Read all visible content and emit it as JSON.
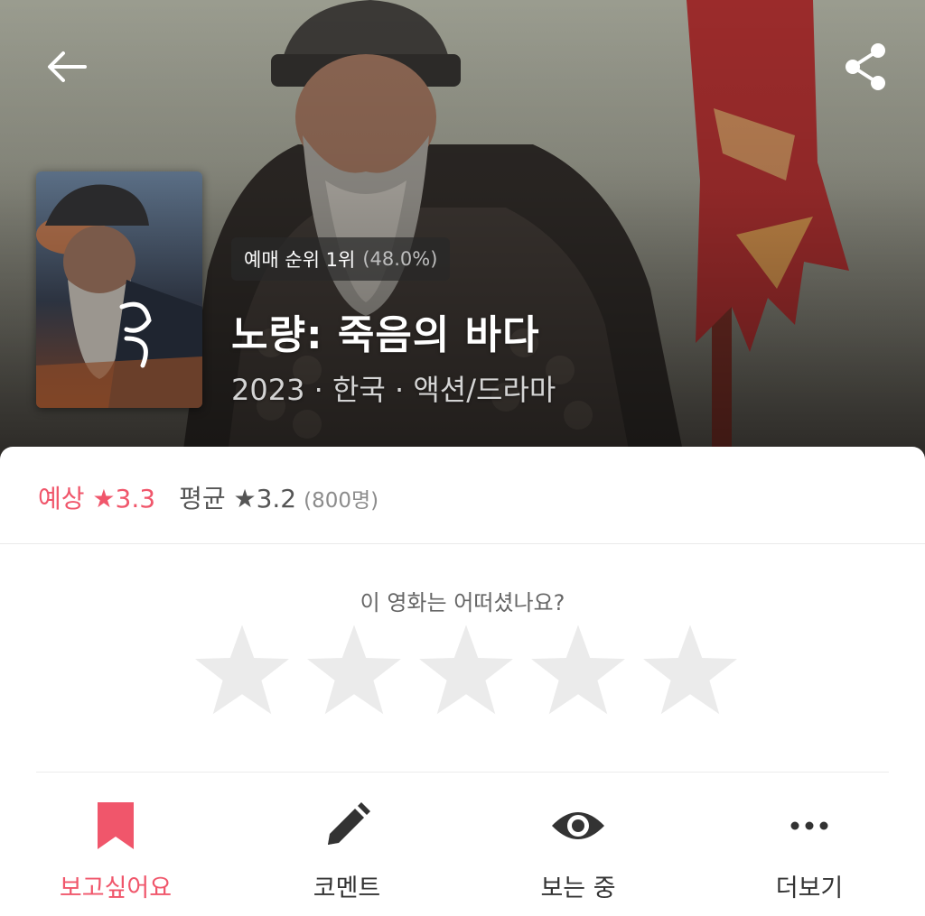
{
  "header": {
    "back_icon": "arrow-left-icon",
    "share_icon": "share-icon"
  },
  "movie": {
    "rank_label": "예매 순위 1위",
    "rank_percent": "(48.0%)",
    "title": "노량: 죽음의 바다",
    "meta": "2023 · 한국 · 액션/드라마"
  },
  "ratings": {
    "expected_label": "예상 ★3.3",
    "average_label": "평균 ★3.2",
    "count_label": "(800명)"
  },
  "rate_prompt": {
    "question": "이 영화는 어떠셨나요?",
    "star_count": 5,
    "current_rating": 0
  },
  "actions": [
    {
      "label": "보고싶어요",
      "icon": "bookmark-icon",
      "active": true
    },
    {
      "label": "코멘트",
      "icon": "pencil-icon",
      "active": false
    },
    {
      "label": "보는 중",
      "icon": "eye-icon",
      "active": false
    },
    {
      "label": "더보기",
      "icon": "more-dots-icon",
      "active": false
    }
  ],
  "colors": {
    "accent": "#f0566b",
    "star_empty": "#ebebeb",
    "text_dark": "#333333"
  }
}
